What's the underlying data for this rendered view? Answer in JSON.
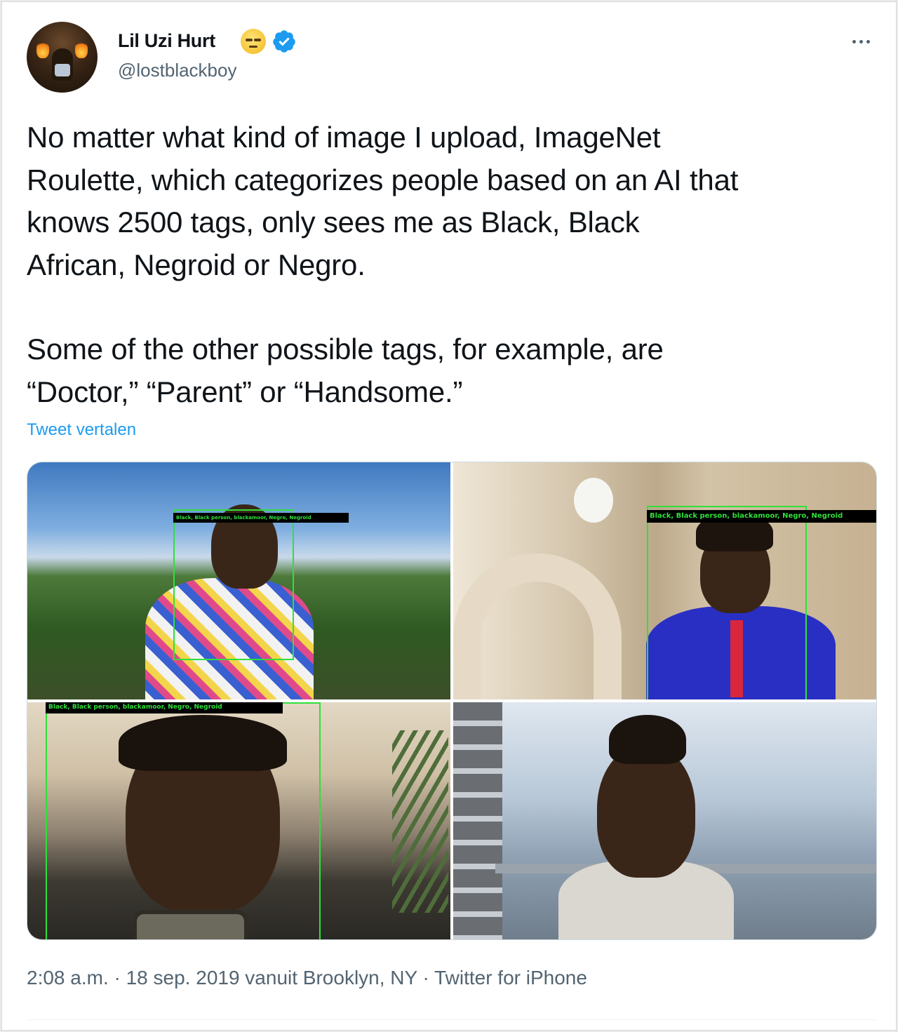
{
  "author": {
    "name": "Lil Uzi Hurt",
    "handle": "@lostblackboy",
    "emoji": "rolling-eyes-face",
    "verified": true
  },
  "tweet": {
    "paragraphs": [
      "No matter what kind of image I upload, ImageNet\nRoulette, which categorizes people based on an AI that\nknows 2500 tags, only sees me as Black, Black\nAfrican, Negroid or Negro.",
      "Some of the other possible tags, for example, are\n“Doctor,” “Parent” or “Handsome.”"
    ],
    "translate_label": "Tweet vertalen"
  },
  "media": {
    "photos": [
      {
        "label": "Black, Black person, blackamoor, Negro, Negroid"
      },
      {
        "label": "Black, Black person, blackamoor, Negro, Negroid"
      },
      {
        "label": "Black, Black person, blackamoor, Negro, Negroid"
      },
      {
        "label": ""
      }
    ]
  },
  "footer": {
    "timestamp": "2:08 a.m. · 18 sep. 2019 vanuit Brooklyn, NY · Twitter for iPhone"
  },
  "colors": {
    "link": "#1d9bf0",
    "verified": "#1d9bf0",
    "secondary_text": "#536471",
    "detection_box": "#2fe03a"
  }
}
